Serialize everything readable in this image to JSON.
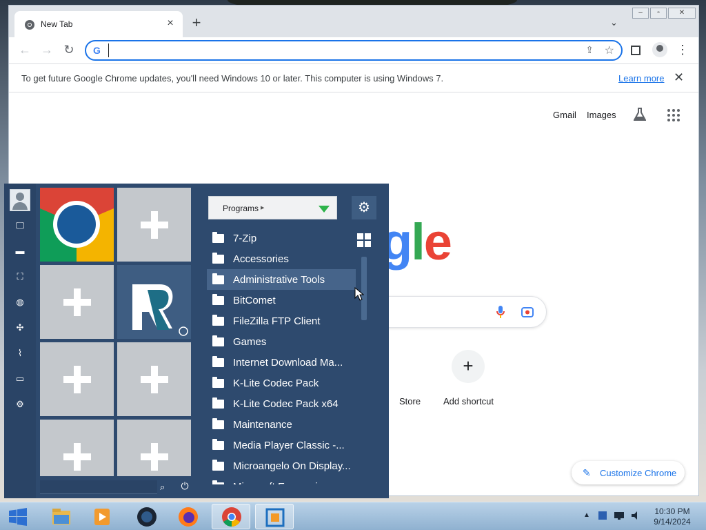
{
  "browser": {
    "tab_title": "New Tab",
    "omnibox": {
      "value": "",
      "placeholder": ""
    },
    "infobar": {
      "message": "To get future Google Chrome updates, you'll need Windows 10 or later. This computer is using Windows 7.",
      "learn_more": "Learn more"
    },
    "ntp": {
      "gmail": "Gmail",
      "images": "Images",
      "logo_partial": "gle",
      "shortcut_partial_label": "Store",
      "add_shortcut": "Add shortcut",
      "customize": "Customize Chrome"
    }
  },
  "start_menu": {
    "programs_dropdown": "Programs",
    "programs": [
      {
        "label": "7-Zip",
        "selected": false
      },
      {
        "label": "Accessories",
        "selected": false
      },
      {
        "label": "Administrative Tools",
        "selected": true
      },
      {
        "label": "BitComet",
        "selected": false
      },
      {
        "label": "FileZilla FTP Client",
        "selected": false
      },
      {
        "label": "Games",
        "selected": false
      },
      {
        "label": "Internet Download Ma...",
        "selected": false
      },
      {
        "label": "K-Lite Codec Pack",
        "selected": false
      },
      {
        "label": "K-Lite Codec Pack x64",
        "selected": false
      },
      {
        "label": "Maintenance",
        "selected": false
      },
      {
        "label": "Media Player Classic -...",
        "selected": false
      },
      {
        "label": "Microangelo On Display...",
        "selected": false
      },
      {
        "label": "Microsoft Expression",
        "selected": false
      }
    ],
    "rail_icons": [
      "user-avatar-icon",
      "monitor-icon",
      "folder-icon",
      "network-icon",
      "globe-icon",
      "puzzle-icon",
      "chart-icon",
      "display-icon",
      "gear-icon"
    ]
  },
  "taskbar": {
    "apps": [
      "file-explorer-icon",
      "media-player-icon",
      "app-dark-globe-icon",
      "firefox-icon",
      "chrome-icon",
      "virtualbox-icon"
    ],
    "active_app": "chrome-icon",
    "clock_time": "10:30 PM",
    "clock_date": "9/14/2024"
  },
  "colors": {
    "start_menu_bg": "#2e4a6e",
    "accent_blue": "#1a73e8",
    "dropdown_arrow": "#2db34a"
  }
}
